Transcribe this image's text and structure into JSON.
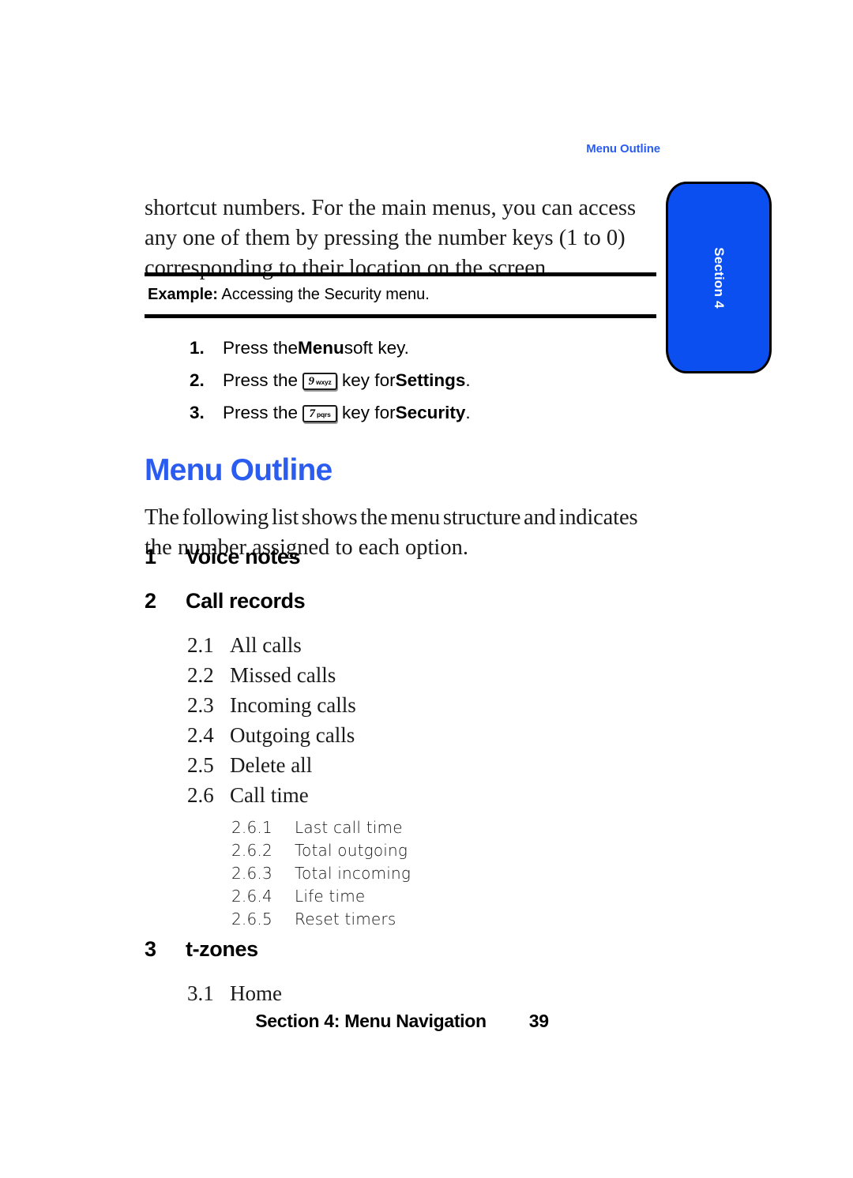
{
  "running_header": "Menu Outline",
  "section_tab": {
    "label": "Section 4",
    "color": "#0b4ff0"
  },
  "intro_paragraph": "shortcut numbers. For the main menus, you can access any one of them by pressing the number keys (1 to 0) corresponding to their location on the screen.",
  "example": {
    "label": "Example:",
    "text": "Accessing the Security menu.",
    "steps": [
      {
        "num": "1.",
        "before": "Press the ",
        "bold": "Menu",
        "after": " soft key.",
        "key": null
      },
      {
        "num": "2.",
        "before": "Press the ",
        "key": {
          "digit": "9",
          "letters": "wxyz"
        },
        "mid": " key for ",
        "bold": "Settings",
        "after": "."
      },
      {
        "num": "3.",
        "before": "Press the ",
        "key": {
          "digit": "7",
          "letters": "pqrs"
        },
        "mid": " key for ",
        "bold": "Security",
        "after": "."
      }
    ]
  },
  "main_heading": "Menu Outline",
  "heading_color": "#2b5cf0",
  "lead_paragraph_line1": "The following list shows the menu structure and indicates",
  "lead_paragraph_line2": "the number assigned to each option.",
  "outline": [
    {
      "level": 1,
      "num": "1",
      "label": "Voice notes"
    },
    {
      "level": 1,
      "num": "2",
      "label": "Call records"
    },
    {
      "level": 2,
      "num": "2.1",
      "label": "All calls"
    },
    {
      "level": 2,
      "num": "2.2",
      "label": "Missed calls"
    },
    {
      "level": 2,
      "num": "2.3",
      "label": "Incoming calls"
    },
    {
      "level": 2,
      "num": "2.4",
      "label": "Outgoing calls"
    },
    {
      "level": 2,
      "num": "2.5",
      "label": "Delete all"
    },
    {
      "level": 2,
      "num": "2.6",
      "label": "Call time"
    },
    {
      "level": 3,
      "num": "2.6.1",
      "label": "Last call time"
    },
    {
      "level": 3,
      "num": "2.6.2",
      "label": "Total outgoing"
    },
    {
      "level": 3,
      "num": "2.6.3",
      "label": "Total incoming"
    },
    {
      "level": 3,
      "num": "2.6.4",
      "label": "Life time"
    },
    {
      "level": 3,
      "num": "2.6.5",
      "label": "Reset timers"
    },
    {
      "level": 1,
      "num": "3",
      "label": "t-zones"
    },
    {
      "level": 2,
      "num": "3.1",
      "label": "Home"
    }
  ],
  "footer": {
    "title": "Section 4: Menu Navigation",
    "page": "39"
  }
}
